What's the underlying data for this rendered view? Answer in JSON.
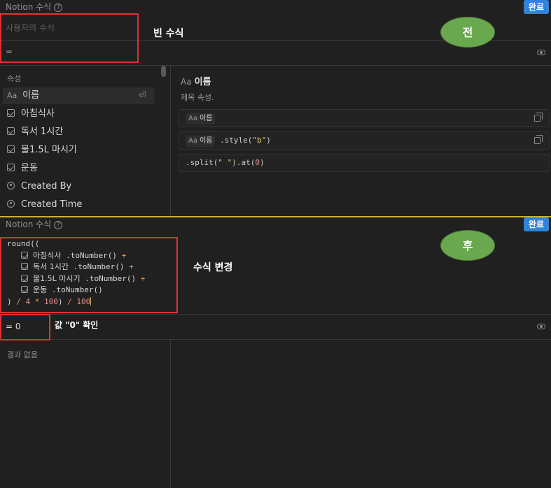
{
  "panel_before": {
    "title": "Notion 수식",
    "help_icon": "?",
    "done_label": "완료",
    "formula_placeholder": "사용자의 수식",
    "result_prefix": "=",
    "annotation": "빈 수식",
    "badge": "전",
    "section_label": "속성",
    "properties": [
      {
        "icon": "Aa",
        "label": "이름",
        "type": "title"
      },
      {
        "icon": "checkbox-icon",
        "label": "아침식사",
        "type": "checkbox"
      },
      {
        "icon": "checkbox-icon",
        "label": "독서 1시간",
        "type": "checkbox"
      },
      {
        "icon": "checkbox-icon",
        "label": "물1.5L 마시기",
        "type": "checkbox"
      },
      {
        "icon": "checkbox-icon",
        "label": "운동",
        "type": "checkbox"
      },
      {
        "icon": "user-circle-icon",
        "label": "Created By",
        "type": "person"
      },
      {
        "icon": "clock-icon",
        "label": "Created Time",
        "type": "time"
      }
    ],
    "detail": {
      "icon": "Aa",
      "title": "이름",
      "description": "제목 속성.",
      "example1_chip": "이름",
      "example2_chip": "이름",
      "example2_code_prefix": " .style(",
      "example2_string": "\"b\"",
      "example2_code_suffix": ")",
      "example3_code_prefix": ".split(",
      "example3_string": "\" \"",
      "example3_code_mid": ").at(",
      "example3_number": "0",
      "example3_code_suffix": ")"
    }
  },
  "panel_after": {
    "title": "Notion 수식",
    "help_icon": "?",
    "done_label": "완료",
    "badge": "후",
    "annotation": "수식 변경",
    "code_first": "round((",
    "code_lines": [
      {
        "chip": "아침식사",
        "rest": " .toNumber() ",
        "op": "+"
      },
      {
        "chip": "독서 1시간",
        "rest": " .toNumber() ",
        "op": "+"
      },
      {
        "chip": "물1.5L 마시기",
        "rest": " .toNumber() ",
        "op": "+"
      },
      {
        "chip": "운동",
        "rest": " .toNumber()",
        "op": ""
      }
    ],
    "code_last_a": ") ",
    "code_last_op1": "/",
    "code_last_num1": " 4 ",
    "code_last_op2": "*",
    "code_last_num2": " 100",
    "code_last_b": ") ",
    "code_last_op3": "/",
    "code_last_num3": " 100",
    "result_text": "= 0",
    "result_annotation": "값 \"0\" 확인",
    "no_result": "결과 없음"
  },
  "colors": {
    "panel_bg": "#202020",
    "accent_blue": "#2f83d9",
    "badge_green": "#6aa84f",
    "highlight_red": "#e03131"
  }
}
